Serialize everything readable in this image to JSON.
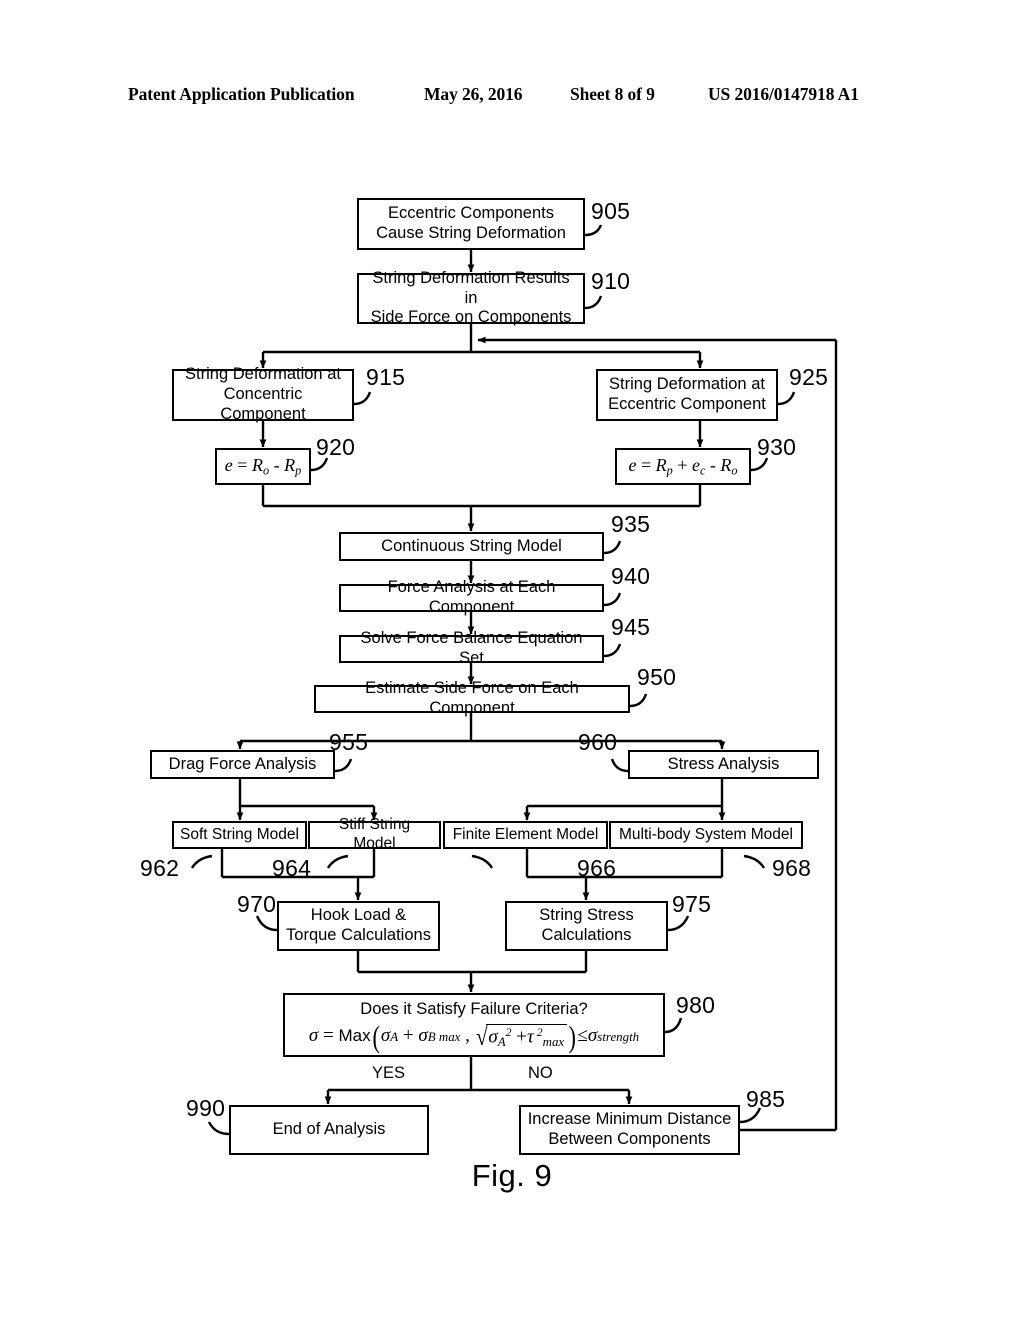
{
  "header": {
    "publication": "Patent Application Publication",
    "date": "May 26, 2016",
    "sheet": "Sheet 8 of 9",
    "number": "US 2016/0147918 A1"
  },
  "figure": {
    "caption": "Fig. 9",
    "line_color": "#000000",
    "background": "#ffffff"
  },
  "flowchart": {
    "nodes": [
      {
        "ref": "905",
        "label": "Eccentric Components\nCause String Deformation"
      },
      {
        "ref": "910",
        "label": "String Deformation Results in\nSide Force on Components"
      },
      {
        "ref": "915",
        "label": "String Deformation at\nConcentric Component"
      },
      {
        "ref": "925",
        "label": "String Deformation at\nEccentric Component"
      },
      {
        "ref": "920",
        "equation": "e = R_o - R_p"
      },
      {
        "ref": "930",
        "equation": "e = R_p + e_c - R_o"
      },
      {
        "ref": "935",
        "label": "Continuous String Model"
      },
      {
        "ref": "940",
        "label": "Force Analysis at Each Component"
      },
      {
        "ref": "945",
        "label": "Solve Force Balance Equation Set"
      },
      {
        "ref": "950",
        "label": "Estimate Side Force on Each Component"
      },
      {
        "ref": "955",
        "label": "Drag Force Analysis"
      },
      {
        "ref": "960",
        "label": "Stress Analysis"
      },
      {
        "ref": "962",
        "label": "Soft String Model"
      },
      {
        "ref": "964",
        "label": "Stiff String Model"
      },
      {
        "ref": "966",
        "label": "Finite Element Model"
      },
      {
        "ref": "968",
        "label": "Multi-body System Model"
      },
      {
        "ref": "970",
        "label": "Hook Load &\nTorque Calculations"
      },
      {
        "ref": "975",
        "label": "String Stress\nCalculations"
      },
      {
        "ref": "980",
        "label": "Does it Satisfy Failure Criteria?",
        "equation": "sigma = Max(sigma_A + sigma_B max , sqrt(sigma_A^2 + tau^2_max)) <= sigma_strength"
      },
      {
        "ref": "990",
        "label": "End of Analysis"
      },
      {
        "ref": "985",
        "label": "Increase Minimum Distance\nBetween Components"
      }
    ],
    "branches": {
      "yes": "YES",
      "no": "NO"
    }
  }
}
